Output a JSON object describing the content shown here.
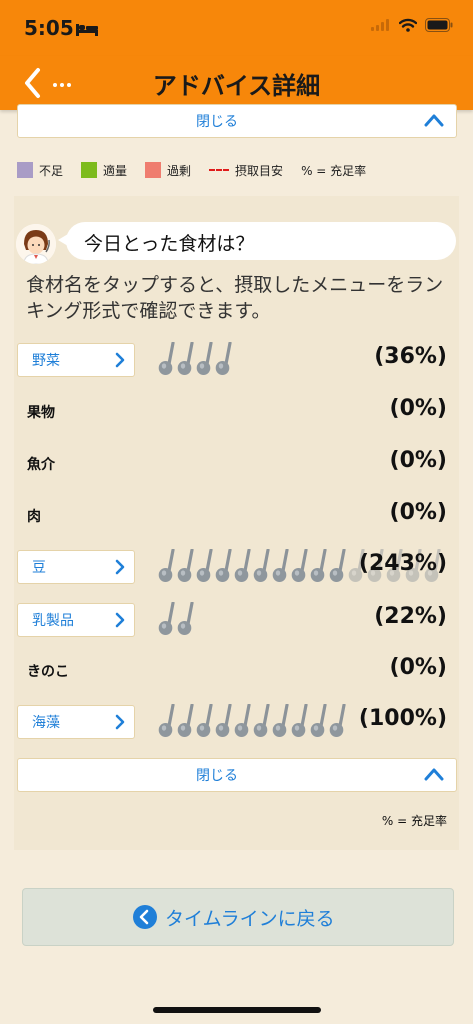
{
  "status": {
    "time": "5:05"
  },
  "nav": {
    "title": "アドバイス詳細"
  },
  "top_close": {
    "label": "閉じる"
  },
  "legend": {
    "items": [
      {
        "label": "不足",
        "color": "#a99cc6"
      },
      {
        "label": "適量",
        "color": "#7dbb1d"
      },
      {
        "label": "過剰",
        "color": "#ef7d6f"
      },
      {
        "label": "摂取目安",
        "color": "#e01a1a"
      }
    ],
    "pct_note": "% = 充足率"
  },
  "question": {
    "text": "今日とった食材は？"
  },
  "description": "食材名をタップすると、摂取したメニューをランキング形式で確認できます。",
  "foods": [
    {
      "name": "野菜",
      "tappable": true,
      "spoons": 4,
      "ghost_spoons": 0,
      "pct": "(36%)"
    },
    {
      "name": "果物",
      "tappable": false,
      "spoons": 0,
      "ghost_spoons": 0,
      "pct": "(0%)"
    },
    {
      "name": "魚介",
      "tappable": false,
      "spoons": 0,
      "ghost_spoons": 0,
      "pct": "(0%)"
    },
    {
      "name": "肉",
      "tappable": false,
      "spoons": 0,
      "ghost_spoons": 0,
      "pct": "(0%)"
    },
    {
      "name": "豆",
      "tappable": true,
      "spoons": 10,
      "ghost_spoons": 5,
      "pct": "(243%)"
    },
    {
      "name": "乳製品",
      "tappable": true,
      "spoons": 2,
      "ghost_spoons": 0,
      "pct": "(22%)"
    },
    {
      "name": "きのこ",
      "tappable": false,
      "spoons": 0,
      "ghost_spoons": 0,
      "pct": "(0%)"
    },
    {
      "name": "海藻",
      "tappable": true,
      "spoons": 10,
      "ghost_spoons": 0,
      "pct": "(100%)"
    }
  ],
  "bottom_close": {
    "label": "閉じる"
  },
  "footer_note": "% = 充足率",
  "return_button": {
    "label": "タイムラインに戻る"
  }
}
